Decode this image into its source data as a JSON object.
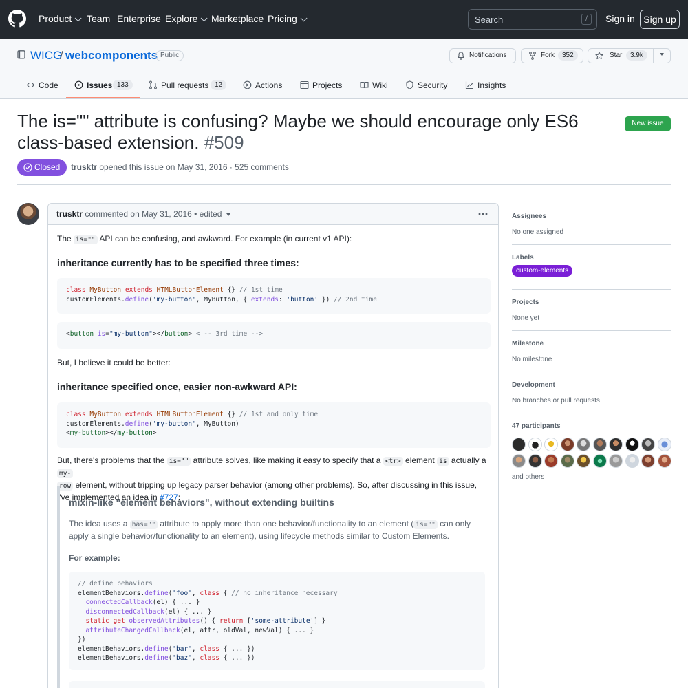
{
  "topnav": {
    "items": [
      "Product",
      "Team",
      "Enterprise",
      "Explore",
      "Marketplace",
      "Pricing"
    ],
    "search_placeholder": "Search",
    "search_shortcut": "/",
    "signin": "Sign in",
    "signup": "Sign up"
  },
  "repo": {
    "owner": "WICG",
    "separator": "/",
    "name": "webcomponents",
    "visibility": "Public",
    "notifications": "Notifications",
    "fork_label": "Fork",
    "fork_count": "352",
    "star_label": "Star",
    "star_count": "3.9k"
  },
  "tabs": [
    {
      "label": "Code",
      "count": ""
    },
    {
      "label": "Issues",
      "count": "133"
    },
    {
      "label": "Pull requests",
      "count": "12"
    },
    {
      "label": "Actions",
      "count": ""
    },
    {
      "label": "Projects",
      "count": ""
    },
    {
      "label": "Wiki",
      "count": ""
    },
    {
      "label": "Security",
      "count": ""
    },
    {
      "label": "Insights",
      "count": ""
    }
  ],
  "issue": {
    "title": "The is=\"\" attribute is confusing? Maybe we should encourage only ES6 class-based extension.",
    "number": "#509",
    "new_issue": "New issue",
    "state": "Closed",
    "author": "trusktr",
    "meta": "opened this issue on May 31, 2016 · 525 comments"
  },
  "comment": {
    "author": "trusktr",
    "meta": "commented on May 31, 2016 •",
    "edited": "edited",
    "p1_a": "The",
    "p1_code": "is=\"\"",
    "p1_b": "API can be confusing, and awkward. For example (in current v1 API):",
    "h1": "inheritance currently has to be specified three times:",
    "p2": "But, I believe it could be better:",
    "h2": "inheritance specified once, easier non-awkward API:",
    "p3_a": "But, there's problems that the",
    "p3_code1": "is=\"\"",
    "p3_b": "attribute solves, like making it easy to specify that a",
    "p3_code2": "<tr>",
    "p3_c": "element",
    "p3_code3": "is",
    "p3_d": "actually a",
    "p3_code4a": "my-",
    "p3_code4b": "row",
    "p3_e": "element, without tripping up legacy parser behavior (among other problems). So, after discussing in this issue, I've implemented an idea in",
    "p3_link": "#727",
    "p3_f": ":",
    "quote_h": "mixin-like \"element behaviors\", without extending builtins",
    "quote_p_a": "The idea uses a",
    "quote_p_code1": "has=\"\"",
    "quote_p_b": "attribute to apply more than one behavior/functionality to an element (",
    "quote_p_code2": "is=\"\"",
    "quote_p_c": "can only apply a single behavior/functionality to an element), using lifecycle methods similar to Custom Elements.",
    "quote_for_example": "For example:"
  },
  "sidebar": {
    "assignees_h": "Assignees",
    "assignees_v": "No one assigned",
    "labels_h": "Labels",
    "label": "custom-elements",
    "projects_h": "Projects",
    "projects_v": "None yet",
    "milestone_h": "Milestone",
    "milestone_v": "No milestone",
    "development_h": "Development",
    "development_v": "No branches or pull requests",
    "participants_h": "47 participants",
    "participants_more": "and others"
  },
  "colors": {
    "header_bg": "#24292f",
    "closed": "#8250df",
    "new_issue": "#2da44e",
    "label": "#7a1fd6",
    "link": "#0969da"
  }
}
